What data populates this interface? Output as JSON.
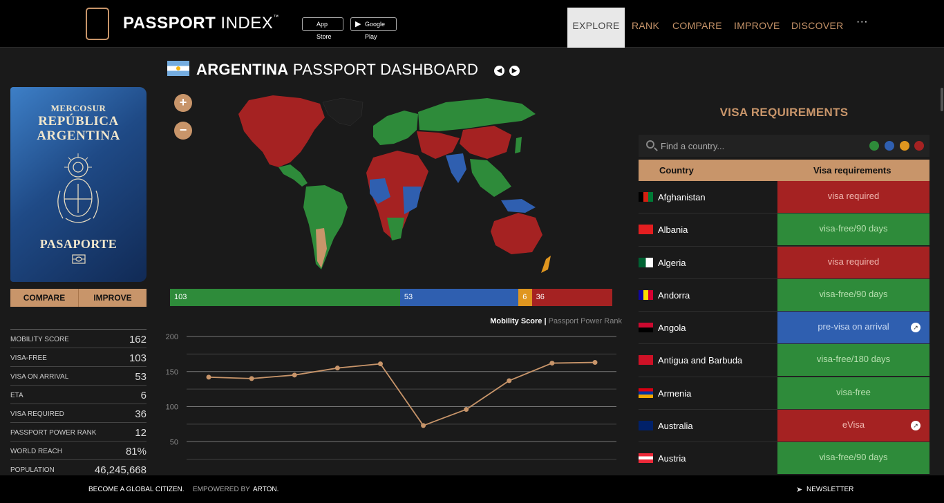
{
  "brand": {
    "bold": "PASSPORT",
    "light": "INDEX",
    "tm": "™"
  },
  "stores": [
    {
      "icon": "apple-icon",
      "label": "App Store"
    },
    {
      "icon": "play-icon",
      "label": "Google Play"
    }
  ],
  "nav": {
    "items": [
      "EXPLORE",
      "RANK",
      "COMPARE",
      "IMPROVE",
      "DISCOVER"
    ],
    "more": "···",
    "active": "EXPLORE"
  },
  "passport": {
    "line1": "MERCOSUR",
    "line2a": "REPÚBLICA",
    "line2b": "ARGENTINA",
    "line3": "PASAPORTE"
  },
  "passport_buttons": {
    "compare": "COMPARE",
    "improve": "IMPROVE"
  },
  "stats": [
    {
      "label": "MOBILITY SCORE",
      "value": "162"
    },
    {
      "label": "VISA-FREE",
      "value": "103"
    },
    {
      "label": "VISA ON ARRIVAL",
      "value": "53"
    },
    {
      "label": "ETA",
      "value": "6"
    },
    {
      "label": "VISA REQUIRED",
      "value": "36"
    },
    {
      "label": "PASSPORT POWER RANK",
      "value": "12"
    },
    {
      "label": "WORLD REACH",
      "value": "81%"
    },
    {
      "label": "POPULATION",
      "value": "46,245,668"
    }
  ],
  "dashboard": {
    "country": "ARGENTINA",
    "suffix": "PASSPORT DASHBOARD"
  },
  "zoom": {
    "in": "+",
    "out": "−"
  },
  "colors": {
    "green": "#2e8b3a",
    "blue": "#2f5fb0",
    "orange": "#e0961f",
    "red": "#a52222",
    "accent": "#c8956a"
  },
  "distribution": [
    {
      "value": 103,
      "color": "#2e8b3a"
    },
    {
      "value": 53,
      "color": "#2f5fb0"
    },
    {
      "value": 6,
      "color": "#e0961f"
    },
    {
      "value": 36,
      "color": "#a52222"
    }
  ],
  "chart_data": {
    "type": "line",
    "legend_active": "Mobility Score",
    "legend_sep": "|",
    "legend_inactive": "Passport Power Rank",
    "ylim": [
      0,
      200
    ],
    "yticks": [
      50,
      100,
      150,
      200
    ],
    "series": [
      {
        "values": [
          142,
          140,
          145,
          155,
          161,
          73,
          96,
          137,
          162,
          163
        ]
      }
    ]
  },
  "visa": {
    "title": "VISA REQUIREMENTS",
    "search_placeholder": "Find a country...",
    "col_country": "Country",
    "col_req": "Visa requirements",
    "rows": [
      {
        "country": "Afghanistan",
        "req": "visa required",
        "type": "red",
        "link": false
      },
      {
        "country": "Albania",
        "req": "visa-free/90 days",
        "type": "green",
        "link": false
      },
      {
        "country": "Algeria",
        "req": "visa required",
        "type": "red",
        "link": false
      },
      {
        "country": "Andorra",
        "req": "visa-free/90 days",
        "type": "green",
        "link": false
      },
      {
        "country": "Angola",
        "req": "pre-visa on arrival",
        "type": "blue",
        "link": true
      },
      {
        "country": "Antigua and Barbuda",
        "req": "visa-free/180 days",
        "type": "green",
        "link": false
      },
      {
        "country": "Armenia",
        "req": "visa-free",
        "type": "green",
        "link": false
      },
      {
        "country": "Australia",
        "req": "eVisa",
        "type": "red",
        "link": true
      },
      {
        "country": "Austria",
        "req": "visa-free/90 days",
        "type": "green",
        "link": false
      }
    ]
  },
  "footer": {
    "tagline": "BECOME A GLOBAL CITIZEN.",
    "empowered": "EMPOWERED BY",
    "partner": "ARTON.",
    "newsletter": "NEWSLETTER"
  }
}
